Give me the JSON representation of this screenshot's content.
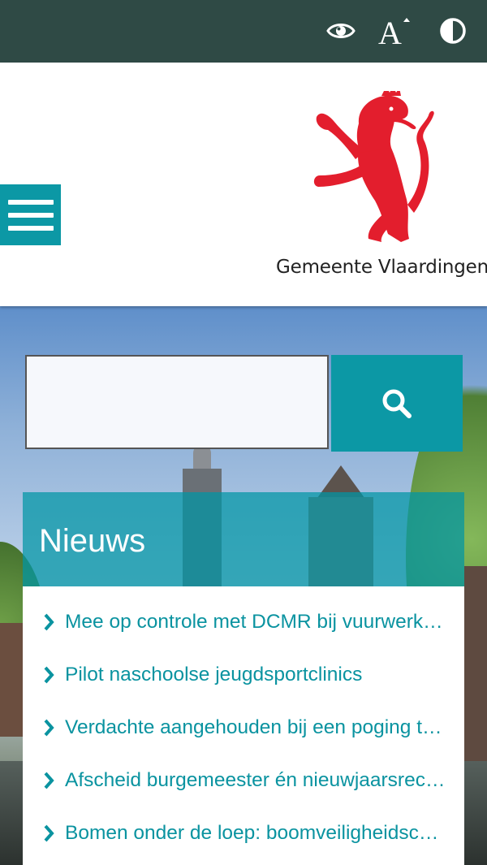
{
  "topbar": {
    "icons": [
      "eye-icon",
      "text-size-icon",
      "contrast-icon"
    ],
    "background": "#2f4a45"
  },
  "header": {
    "logo_text": "Gemeente Vlaardingen",
    "logo_color": "#e31e2d",
    "menu_color": "#0c98a5",
    "menu_icon": "hamburger-icon"
  },
  "search": {
    "value": "",
    "placeholder": "",
    "button_icon": "search-icon"
  },
  "news": {
    "title": "Nieuws",
    "items": [
      {
        "label": "Mee op controle met DCMR bij vuurwerkverkopers"
      },
      {
        "label": "Pilot naschoolse jeugdsportclinics"
      },
      {
        "label": "Verdachte aangehouden bij een poging tot inbraak"
      },
      {
        "label": "Afscheid burgemeester én nieuwjaarsreceptie"
      },
      {
        "label": "Bomen onder de loep: boomveiligheidscontrole"
      }
    ],
    "accent": "#0a93a0"
  }
}
